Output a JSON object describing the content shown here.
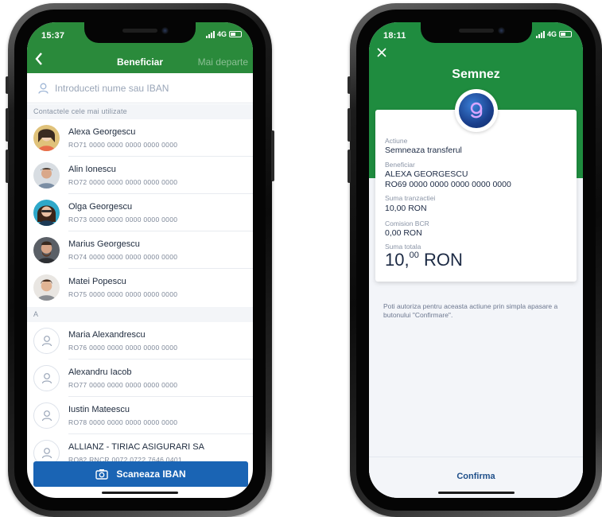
{
  "left_phone": {
    "status": {
      "time": "15:37",
      "network": "4G"
    },
    "header": {
      "back_icon": "chevron-left-icon",
      "title": "Beneficiar",
      "next_label": "Mai departe"
    },
    "search": {
      "placeholder": "Introduceti nume sau IBAN",
      "icon": "person-icon"
    },
    "frequent_header": "Contactele cele mai utilizate",
    "frequent": [
      {
        "name": "Alexa Georgescu",
        "iban": "RO71 0000 0000 0000 0000 0000"
      },
      {
        "name": "Alin Ionescu",
        "iban": "RO72 0000 0000 0000 0000 0000"
      },
      {
        "name": "Olga Georgescu",
        "iban": "RO73 0000 0000 0000 0000 0000"
      },
      {
        "name": "Marius Georgescu",
        "iban": "RO74 0000 0000 0000 0000 0000"
      },
      {
        "name": "Matei Popescu",
        "iban": "RO75 0000 0000 0000 0000 0000"
      }
    ],
    "section_a": "A",
    "contacts_a": [
      {
        "name": "Maria Alexandrescu",
        "iban": "RO76 0000 0000 0000 0000 0000"
      },
      {
        "name": "Alexandru Iacob",
        "iban": "RO77 0000 0000 0000 0000 0000"
      },
      {
        "name": "Iustin Mateescu",
        "iban": "RO78 0000 0000 0000 0000 0000"
      },
      {
        "name": "ALLIANZ - TIRIAC ASIGURARI SA",
        "iban": "RO82 RNCR 0072 0722 7646 0401"
      }
    ],
    "scan_button": {
      "label": "Scaneaza IBAN",
      "icon": "camera-icon"
    },
    "colors": {
      "header": "#2a8a3b",
      "button": "#1a64b4"
    }
  },
  "right_phone": {
    "status": {
      "time": "18:11",
      "network": "4G"
    },
    "close_icon": "close-icon",
    "title": "Semnez",
    "logo_icon": "george-logo-icon",
    "fields": {
      "action_label": "Actiune",
      "action_value": "Semneaza transferul",
      "beneficiary_label": "Beneficiar",
      "beneficiary_name": "ALEXA GEORGESCU",
      "beneficiary_iban": "RO69 0000 0000 0000 0000 0000",
      "amount_label": "Suma tranzactiei",
      "amount_value": "10,00 RON",
      "fee_label": "Comision BCR",
      "fee_value": "0,00 RON",
      "total_label": "Suma totala",
      "total_int": "10,",
      "total_dec": "00",
      "total_currency": "RON"
    },
    "note": "Poti autoriza pentru aceasta actiune prin simpla apasare a butonului \"Confirmare\".",
    "confirm_label": "Confirma",
    "colors": {
      "header": "#1f8c3f",
      "text": "#1c2a44"
    }
  }
}
